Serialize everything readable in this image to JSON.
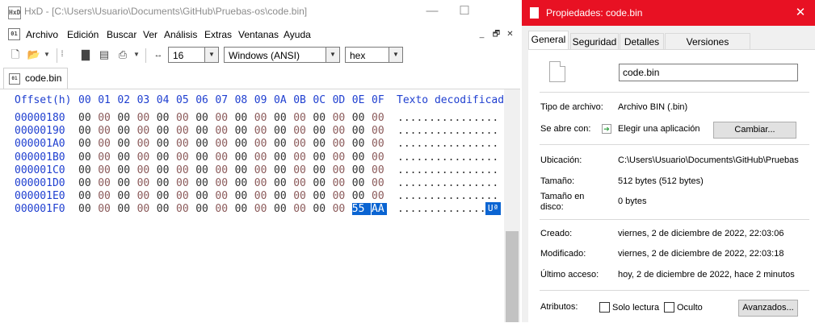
{
  "hxd": {
    "title": "HxD - [C:\\Users\\Usuario\\Documents\\GitHub\\Pruebas-os\\code.bin]",
    "window_controls": {
      "minimize": "—",
      "maximize": "☐"
    },
    "app_icon_text": "HxD",
    "menu": [
      "Archivo",
      "Edición",
      "Buscar",
      "Ver",
      "Análisis",
      "Extras",
      "Ventanas",
      "Ayuda"
    ],
    "mdi_controls": [
      "_",
      "🗗",
      "✕"
    ],
    "toolbar": {
      "icons": [
        "new-file-icon",
        "open-folder-icon",
        "dropdown-arrow-icon",
        "save-icon",
        "disk-icon",
        "print-icon",
        "dropdown-arrow-icon",
        "bytes-per-row-icon"
      ],
      "bytes_per_row": "16",
      "charset": "Windows (ANSI)",
      "offset_base": "hex"
    },
    "tab": {
      "label": "code.bin"
    },
    "header": {
      "offset_label": "Offset(h)",
      "columns": [
        "00",
        "01",
        "02",
        "03",
        "04",
        "05",
        "06",
        "07",
        "08",
        "09",
        "0A",
        "0B",
        "0C",
        "0D",
        "0E",
        "0F"
      ],
      "text_label": "Texto decodificado"
    },
    "rows": [
      {
        "offset": "00000180",
        "bytes": [
          "00",
          "00",
          "00",
          "00",
          "00",
          "00",
          "00",
          "00",
          "00",
          "00",
          "00",
          "00",
          "00",
          "00",
          "00",
          "00"
        ],
        "text": "................"
      },
      {
        "offset": "00000190",
        "bytes": [
          "00",
          "00",
          "00",
          "00",
          "00",
          "00",
          "00",
          "00",
          "00",
          "00",
          "00",
          "00",
          "00",
          "00",
          "00",
          "00"
        ],
        "text": "................"
      },
      {
        "offset": "000001A0",
        "bytes": [
          "00",
          "00",
          "00",
          "00",
          "00",
          "00",
          "00",
          "00",
          "00",
          "00",
          "00",
          "00",
          "00",
          "00",
          "00",
          "00"
        ],
        "text": "................"
      },
      {
        "offset": "000001B0",
        "bytes": [
          "00",
          "00",
          "00",
          "00",
          "00",
          "00",
          "00",
          "00",
          "00",
          "00",
          "00",
          "00",
          "00",
          "00",
          "00",
          "00"
        ],
        "text": "................"
      },
      {
        "offset": "000001C0",
        "bytes": [
          "00",
          "00",
          "00",
          "00",
          "00",
          "00",
          "00",
          "00",
          "00",
          "00",
          "00",
          "00",
          "00",
          "00",
          "00",
          "00"
        ],
        "text": "................"
      },
      {
        "offset": "000001D0",
        "bytes": [
          "00",
          "00",
          "00",
          "00",
          "00",
          "00",
          "00",
          "00",
          "00",
          "00",
          "00",
          "00",
          "00",
          "00",
          "00",
          "00"
        ],
        "text": "................"
      },
      {
        "offset": "000001E0",
        "bytes": [
          "00",
          "00",
          "00",
          "00",
          "00",
          "00",
          "00",
          "00",
          "00",
          "00",
          "00",
          "00",
          "00",
          "00",
          "00",
          "00"
        ],
        "text": "................"
      },
      {
        "offset": "000001F0",
        "bytes": [
          "00",
          "00",
          "00",
          "00",
          "00",
          "00",
          "00",
          "00",
          "00",
          "00",
          "00",
          "00",
          "00",
          "00",
          "55",
          "AA"
        ],
        "text": ".............."
      }
    ],
    "selected_text": "Uª",
    "colors": {
      "offset_blue": "#1f3fd0",
      "selection": "#0a64d2",
      "alt_byte": "#8b5a5a"
    }
  },
  "props": {
    "title": "Propiedades: code.bin",
    "close": "✕",
    "tabs": [
      "General",
      "Seguridad",
      "Detalles",
      "Versiones anteriores"
    ],
    "filename": "code.bin",
    "rows": {
      "tipo_label": "Tipo de archivo:",
      "tipo_value": "Archivo BIN (.bin)",
      "abre_label": "Se abre con:",
      "abre_value": "Elegir una aplicación",
      "cambiar_button": "Cambiar...",
      "ubicacion_label": "Ubicación:",
      "ubicacion_value": "C:\\Users\\Usuario\\Documents\\GitHub\\Pruebas",
      "tamano_label": "Tamaño:",
      "tamano_value": "512 bytes (512 bytes)",
      "tamano_disco_label": "Tamaño en disco:",
      "tamano_disco_value": "0 bytes",
      "creado_label": "Creado:",
      "creado_value": "viernes, 2 de diciembre de 2022, 22:03:06",
      "modificado_label": "Modificado:",
      "modificado_value": "viernes, 2 de diciembre de 2022, 22:03:18",
      "acceso_label": "Último acceso:",
      "acceso_value": "hoy, 2 de diciembre de 2022, hace 2 minutos",
      "atributos_label": "Atributos:",
      "solo_lectura": "Solo lectura",
      "oculto": "Oculto",
      "avanzados_button": "Avanzados..."
    },
    "colors": {
      "titlebar": "#e81123"
    }
  }
}
